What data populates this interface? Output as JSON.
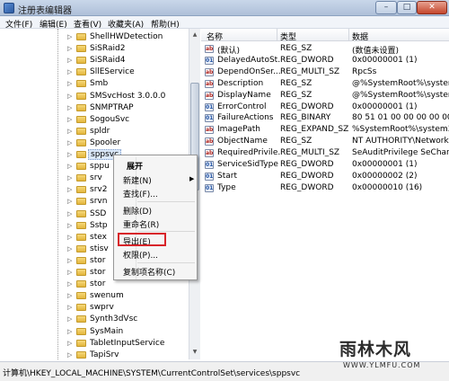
{
  "window": {
    "title": "注册表编辑器",
    "min": "–",
    "max": "□",
    "close": "✕"
  },
  "menu": [
    "文件(F)",
    "编辑(E)",
    "查看(V)",
    "收藏夹(A)",
    "帮助(H)"
  ],
  "tree": {
    "items": [
      "ShellHWDetection",
      "SiSRaid2",
      "SiSRaid4",
      "SllEService",
      "Smb",
      "SMSvcHost 3.0.0.0",
      "SNMPTRAP",
      "SogouSvc",
      "spldr",
      "Spooler",
      "sppsvc",
      "sppu",
      "srv",
      "srv2",
      "srvn",
      "SSD",
      "Sstp",
      "stex",
      "stisv",
      "stor",
      "stor",
      "stor",
      "swenum",
      "swprv",
      "Synth3dVsc",
      "SysMain",
      "TabletInputService",
      "TapiSrv"
    ],
    "selected_index": 10
  },
  "list": {
    "headers": [
      "名称",
      "类型",
      "数据"
    ],
    "rows": [
      {
        "icon": "string-value-icon",
        "name": "(默认)",
        "type": "REG_SZ",
        "data": "(数值未设置)"
      },
      {
        "icon": "binary-value-icon",
        "name": "DelayedAutoSt...",
        "type": "REG_DWORD",
        "data": "0x00000001 (1)"
      },
      {
        "icon": "string-value-icon",
        "name": "DependOnSer...",
        "type": "REG_MULTI_SZ",
        "data": "RpcSs"
      },
      {
        "icon": "string-value-icon",
        "name": "Description",
        "type": "REG_SZ",
        "data": "@%SystemRoot%\\system3"
      },
      {
        "icon": "string-value-icon",
        "name": "DisplayName",
        "type": "REG_SZ",
        "data": "@%SystemRoot%\\system3"
      },
      {
        "icon": "binary-value-icon",
        "name": "ErrorControl",
        "type": "REG_DWORD",
        "data": "0x00000001 (1)"
      },
      {
        "icon": "binary-value-icon",
        "name": "FailureActions",
        "type": "REG_BINARY",
        "data": "80 51 01 00 00 00 00 00 0"
      },
      {
        "icon": "string-value-icon",
        "name": "ImagePath",
        "type": "REG_EXPAND_SZ",
        "data": "%SystemRoot%\\system32\\"
      },
      {
        "icon": "string-value-icon",
        "name": "ObjectName",
        "type": "REG_SZ",
        "data": "NT AUTHORITY\\NetworkS"
      },
      {
        "icon": "string-value-icon",
        "name": "RequiredPrivile...",
        "type": "REG_MULTI_SZ",
        "data": "SeAuditPrivilege SeChange"
      },
      {
        "icon": "binary-value-icon",
        "name": "ServiceSidType",
        "type": "REG_DWORD",
        "data": "0x00000001 (1)"
      },
      {
        "icon": "binary-value-icon",
        "name": "Start",
        "type": "REG_DWORD",
        "data": "0x00000002 (2)"
      },
      {
        "icon": "binary-value-icon",
        "name": "Type",
        "type": "REG_DWORD",
        "data": "0x00000010 (16)"
      }
    ]
  },
  "context_menu": {
    "expand": "展开",
    "new": "新建(N)",
    "find": "查找(F)...",
    "delete": "删除(D)",
    "rename": "重命名(R)",
    "export": "导出(E)",
    "permissions": "权限(P)...",
    "copy_key_name": "复制项名称(C)",
    "submenu_arrow": "▶"
  },
  "status": {
    "path": "计算机\\HKEY_LOCAL_MACHINE\\SYSTEM\\CurrentControlSet\\services\\sppsvc"
  },
  "watermark": {
    "text": "雨林木风",
    "url": "WWW.YLMFU.COM"
  },
  "colors": {
    "highlight_box": "#d8242a",
    "folder": "#e3b63d",
    "selection": "#dbe8f8"
  }
}
